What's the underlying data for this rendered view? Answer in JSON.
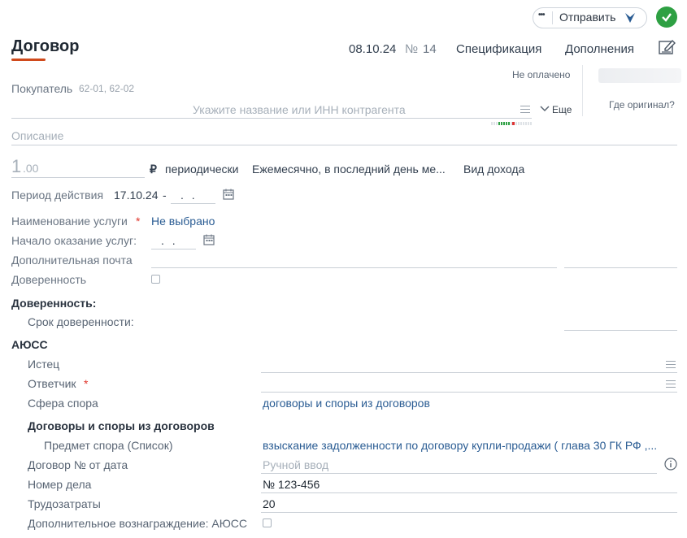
{
  "header": {
    "more_label": "•••",
    "send_label": "Отправить",
    "title": "Договор",
    "date": "08.10.24",
    "number_sign": "№",
    "number": "14",
    "tab_spec": "Спецификация",
    "tab_additions": "Дополнения"
  },
  "status": {
    "payment": "Не оплачено",
    "original_question": "Где оригинал?"
  },
  "buyer": {
    "label": "Покупатель",
    "accounts": "62-01, 62-02",
    "placeholder": "Укажите название или ИНН контрагента",
    "more_label": "Еще"
  },
  "description": {
    "placeholder": "Описание"
  },
  "amount": {
    "int": "1",
    "dec": ".00",
    "currency": "₽",
    "periodicity": "периодически",
    "schedule": "Ежемесячно, в последний день ме...",
    "income_type": "Вид дохода"
  },
  "period": {
    "label": "Период действия",
    "start": "17.10.24",
    "sep": "-",
    "end": " .  ."
  },
  "service": {
    "label": "Наименование услуги",
    "required": "*",
    "value": "Не выбрано"
  },
  "service_start": {
    "label": "Начало оказание услуг:",
    "value": " .  ."
  },
  "extra_email": {
    "label": "Дополнительная почта"
  },
  "poa": {
    "label": "Доверенность",
    "section": "Доверенность:",
    "term_label": "Срок доверенности:"
  },
  "aiuss": {
    "section": "АЮСС",
    "plaintiff_label": "Истец",
    "defendant_label": "Ответчик",
    "required": "*",
    "dispute_sphere_label": "Сфера спора",
    "dispute_sphere_value": "договоры и споры из договоров",
    "subsection": "Договоры и споры из договоров",
    "subject_label": "Предмет спора (Список)",
    "subject_value": "взыскание задолженности по договору купли-продажи ( глава 30 ГК РФ ,...",
    "contract_label": "Договор № от дата",
    "contract_placeholder": "Ручной ввод",
    "case_label": "Номер дела",
    "case_value": "№ 123-456",
    "labor_label": "Трудозатраты",
    "labor_value": "20",
    "extra_reward_label": "Дополнительное вознаграждение: АЮСС"
  },
  "colors": {
    "accent_green": "#2ea043",
    "title_underline": "#d04a1c",
    "link_blue": "#2a5c93"
  }
}
